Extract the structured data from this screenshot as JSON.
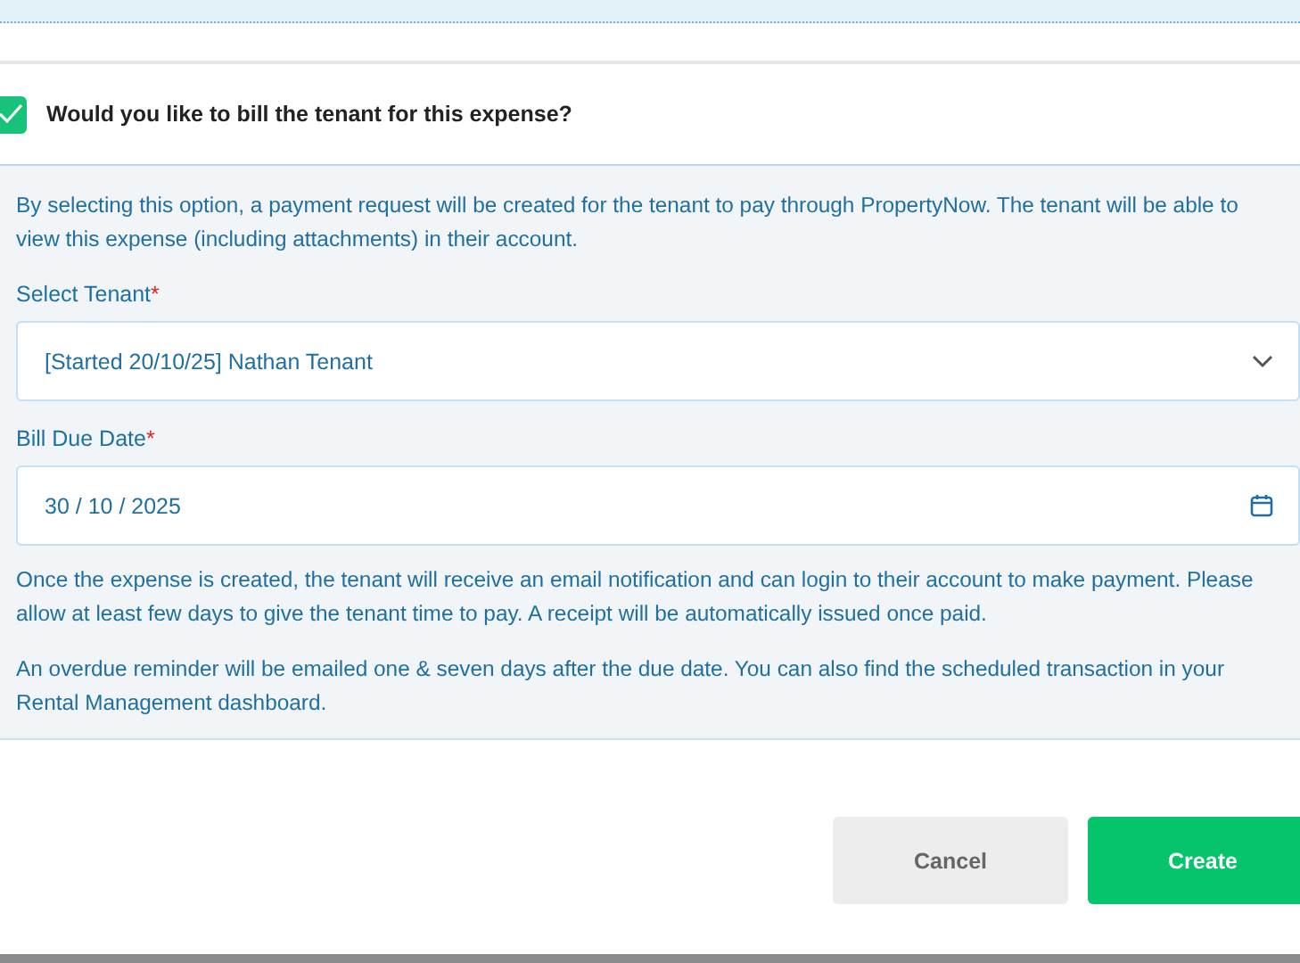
{
  "bill_tenant": {
    "label": "Would you like to bill the tenant for this expense?",
    "checked": true
  },
  "info": "By selecting this option, a payment request will be created for the tenant to pay through PropertyNow. The tenant will be able to view this expense (including attachments) in their account.",
  "fields": [
    {
      "kind": "select",
      "label": "Select Tenant",
      "required_mark": "*",
      "value": "[Started 20/10/25] Nathan Tenant"
    },
    {
      "kind": "date",
      "label": "Bill Due Date",
      "required_mark": "*",
      "value": "30 / 10 / 2025"
    }
  ],
  "notes": [
    "Once the expense is created, the tenant will receive an email notification and can login to their account to make payment. Please allow at least few days to give the tenant time to pay. A receipt will be automatically issued once paid.",
    "An overdue reminder will be emailed one & seven days after the due date. You can also find the scheduled transaction in your Rental Management dashboard."
  ],
  "buttons": [
    {
      "kind": "secondary",
      "label": "Cancel"
    },
    {
      "kind": "primary",
      "label": "Create"
    }
  ]
}
